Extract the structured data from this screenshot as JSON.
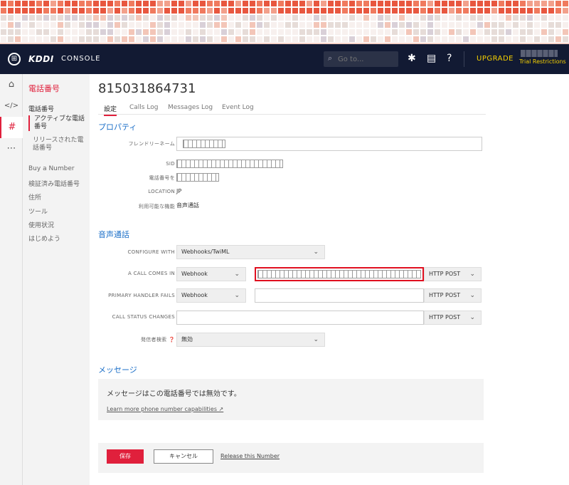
{
  "topbar": {
    "logo_glyph": "⊞",
    "brand": "KDDI",
    "console": "CONSOLE",
    "search_placeholder": "Go to...",
    "search_icon": "⌕",
    "bug_icon": "✱",
    "doc_icon": "▤",
    "help_icon": "?",
    "upgrade": "UPGRADE",
    "trial": "Trial Restrictions"
  },
  "rail": [
    {
      "name": "home-icon",
      "glyph": "⌂"
    },
    {
      "name": "code-icon",
      "glyph": "</>"
    },
    {
      "name": "hash-icon",
      "glyph": "#"
    },
    {
      "name": "more-icon",
      "glyph": "⋯"
    }
  ],
  "nav": {
    "title": "電話番号",
    "section": "電話番号",
    "sub_active": "アクティブな電話番号",
    "sub_released": "リリースされた電話番号",
    "items": [
      "Buy a Number",
      "検証済み電話番号",
      "住所",
      "ツール",
      "使用状況",
      "はじめよう"
    ]
  },
  "main": {
    "number": "815031864731",
    "tabs": [
      "設定",
      "Calls Log",
      "Messages Log",
      "Event Log"
    ],
    "properties": {
      "title": "プロパティ",
      "friendly_name_label": "フレンドリーネーム",
      "sid_label": "SID",
      "phone_label": "電話番号を",
      "location_label": "LOCATION",
      "location_value": "JP",
      "capabilities_label": "利用可能な機能",
      "capabilities_value": "音声通話"
    },
    "voice": {
      "title": "音声通話",
      "configure_label": "CONFIGURE WITH",
      "configure_value": "Webhooks/TwiML",
      "call_comes_label": "A CALL COMES IN",
      "call_comes_type": "Webhook",
      "call_comes_method": "HTTP POST",
      "primary_fail_label": "PRIMARY HANDLER FAILS",
      "primary_fail_type": "Webhook",
      "primary_fail_method": "HTTP POST",
      "status_label": "CALL STATUS CHANGES",
      "status_method": "HTTP POST",
      "caller_label": "発信者検索 ❓",
      "caller_value": "無効",
      "chevron": "⌄"
    },
    "messaging": {
      "title": "メッセージ",
      "text": "メッセージはこの電話番号では無効です。",
      "link": "Learn more phone number capabilities ↗"
    },
    "footer": {
      "save": "保存",
      "cancel": "キャンセル",
      "release": "Release this Number"
    }
  }
}
